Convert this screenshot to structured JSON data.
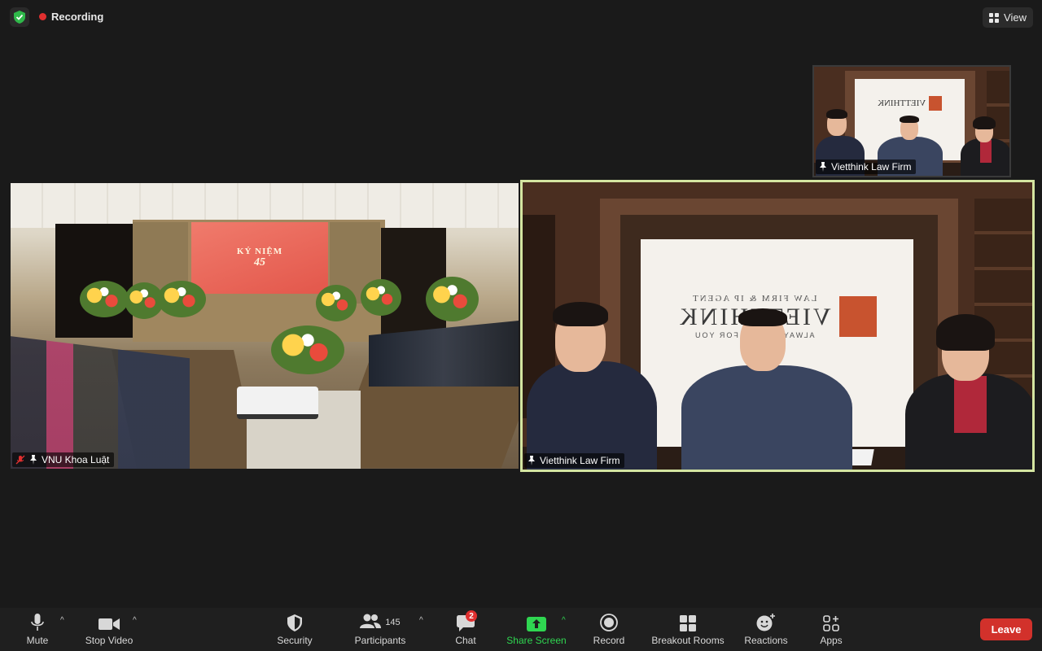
{
  "topbar": {
    "recording_label": "Recording",
    "view_label": "View"
  },
  "tiles": [
    {
      "name": "VNU Khoa Luật",
      "muted": true,
      "pinned": true
    },
    {
      "name": "Vietthink Law Firm",
      "muted": false,
      "pinned": true,
      "active_speaker": true
    },
    {
      "name": "Vietthink Law Firm",
      "muted": false,
      "pinned": true
    }
  ],
  "slide": {
    "line1": "KỶ NIỆM",
    "line2": "45"
  },
  "vietthink_sign": {
    "top": "LAW FIRM & IP AGENT",
    "brand": "VIETTHINK",
    "tagline": "ALWAYS THINK FOR YOU"
  },
  "toolbar": {
    "mute_label": "Mute",
    "stop_video_label": "Stop Video",
    "security_label": "Security",
    "participants_label": "Participants",
    "participants_count": "145",
    "chat_label": "Chat",
    "chat_badge": "2",
    "share_screen_label": "Share Screen",
    "record_label": "Record",
    "breakout_label": "Breakout Rooms",
    "reactions_label": "Reactions",
    "apps_label": "Apps",
    "leave_label": "Leave"
  },
  "colors": {
    "leave": "#d2312b",
    "share_green": "#2fd651",
    "active_speaker_border": "#d4e5a1",
    "recording_dot": "#e02f2f",
    "shield_green": "#2fb84a"
  }
}
